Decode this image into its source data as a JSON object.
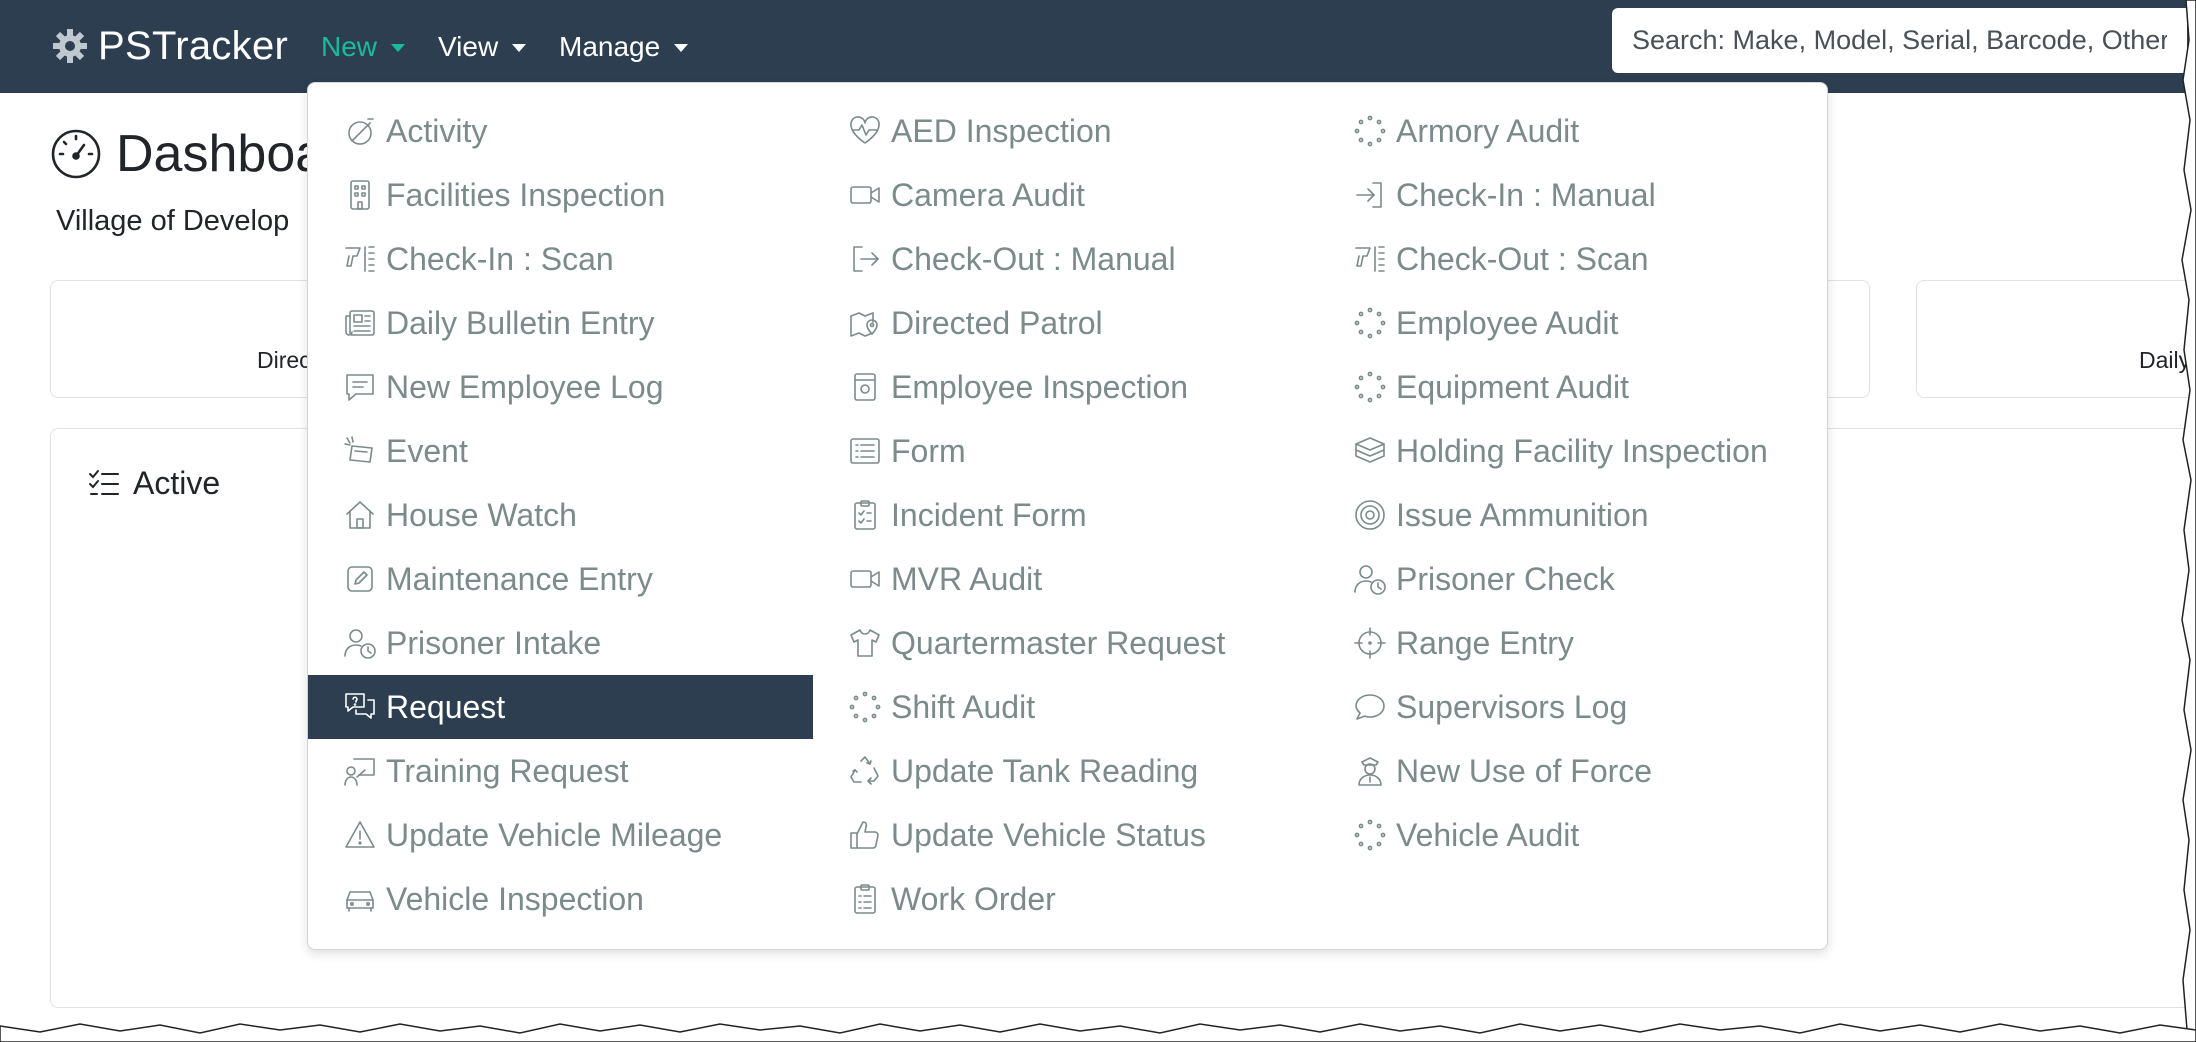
{
  "brand": {
    "name": "PSTracker"
  },
  "nav": [
    {
      "label": "New",
      "active": true
    },
    {
      "label": "View",
      "active": false
    },
    {
      "label": "Manage",
      "active": false
    }
  ],
  "search": {
    "placeholder": "Search: Make, Model, Serial, Barcode, Other"
  },
  "page": {
    "title": "Dashboa",
    "subtitle": "Village of Develop",
    "card_a_label": "Direc",
    "card_c_label": "Daily",
    "active_title": "Active"
  },
  "colors": {
    "navbar": "#2c3e50",
    "accent": "#18bc9c",
    "menu_text": "#7b8a8b",
    "selected_bg": "#2c3e50"
  },
  "menu": {
    "col1": [
      {
        "label": "Activity",
        "icon": "activity-icon"
      },
      {
        "label": "Facilities Inspection",
        "icon": "building-icon"
      },
      {
        "label": "Check-In : Scan",
        "icon": "barcode-scanner-icon"
      },
      {
        "label": "Daily Bulletin Entry",
        "icon": "newspaper-icon"
      },
      {
        "label": "New Employee Log",
        "icon": "message-square-icon"
      },
      {
        "label": "Event",
        "icon": "event-icon"
      },
      {
        "label": "House Watch",
        "icon": "house-icon"
      },
      {
        "label": "Maintenance Entry",
        "icon": "edit-icon"
      },
      {
        "label": "Prisoner Intake",
        "icon": "person-clock-icon"
      },
      {
        "label": "Request",
        "icon": "question-chat-icon",
        "selected": true
      },
      {
        "label": "Training Request",
        "icon": "person-board-icon"
      },
      {
        "label": "Update Vehicle Mileage",
        "icon": "warning-icon"
      },
      {
        "label": "Vehicle Inspection",
        "icon": "car-icon"
      }
    ],
    "col2": [
      {
        "label": "AED Inspection",
        "icon": "heart-pulse-icon"
      },
      {
        "label": "Camera Audit",
        "icon": "video-camera-icon"
      },
      {
        "label": "Check-Out : Manual",
        "icon": "sign-out-icon"
      },
      {
        "label": "Directed Patrol",
        "icon": "map-pin-icon"
      },
      {
        "label": "Employee Inspection",
        "icon": "badge-icon"
      },
      {
        "label": "Form",
        "icon": "list-box-icon"
      },
      {
        "label": "Incident Form",
        "icon": "clipboard-check-icon"
      },
      {
        "label": "MVR Audit",
        "icon": "video-camera-icon"
      },
      {
        "label": "Quartermaster Request",
        "icon": "shirt-icon"
      },
      {
        "label": "Shift Audit",
        "icon": "spinner-dots-icon"
      },
      {
        "label": "Update Tank Reading",
        "icon": "recycle-icon"
      },
      {
        "label": "Update Vehicle Status",
        "icon": "thumbs-up-icon"
      },
      {
        "label": "Work Order",
        "icon": "clipboard-list-icon"
      }
    ],
    "col3": [
      {
        "label": "Armory Audit",
        "icon": "spinner-dots-icon"
      },
      {
        "label": "Check-In : Manual",
        "icon": "sign-in-icon"
      },
      {
        "label": "Check-Out : Scan",
        "icon": "barcode-scanner-icon"
      },
      {
        "label": "Employee Audit",
        "icon": "spinner-dots-icon"
      },
      {
        "label": "Equipment Audit",
        "icon": "spinner-dots-icon"
      },
      {
        "label": "Holding Facility Inspection",
        "icon": "box-stack-icon"
      },
      {
        "label": "Issue Ammunition",
        "icon": "target-icon"
      },
      {
        "label": "Prisoner Check",
        "icon": "person-clock-icon"
      },
      {
        "label": "Range Entry",
        "icon": "crosshair-icon"
      },
      {
        "label": "Supervisors Log",
        "icon": "speech-bubble-icon"
      },
      {
        "label": "New Use of Force",
        "icon": "officer-icon"
      },
      {
        "label": "Vehicle Audit",
        "icon": "spinner-dots-icon"
      }
    ]
  }
}
